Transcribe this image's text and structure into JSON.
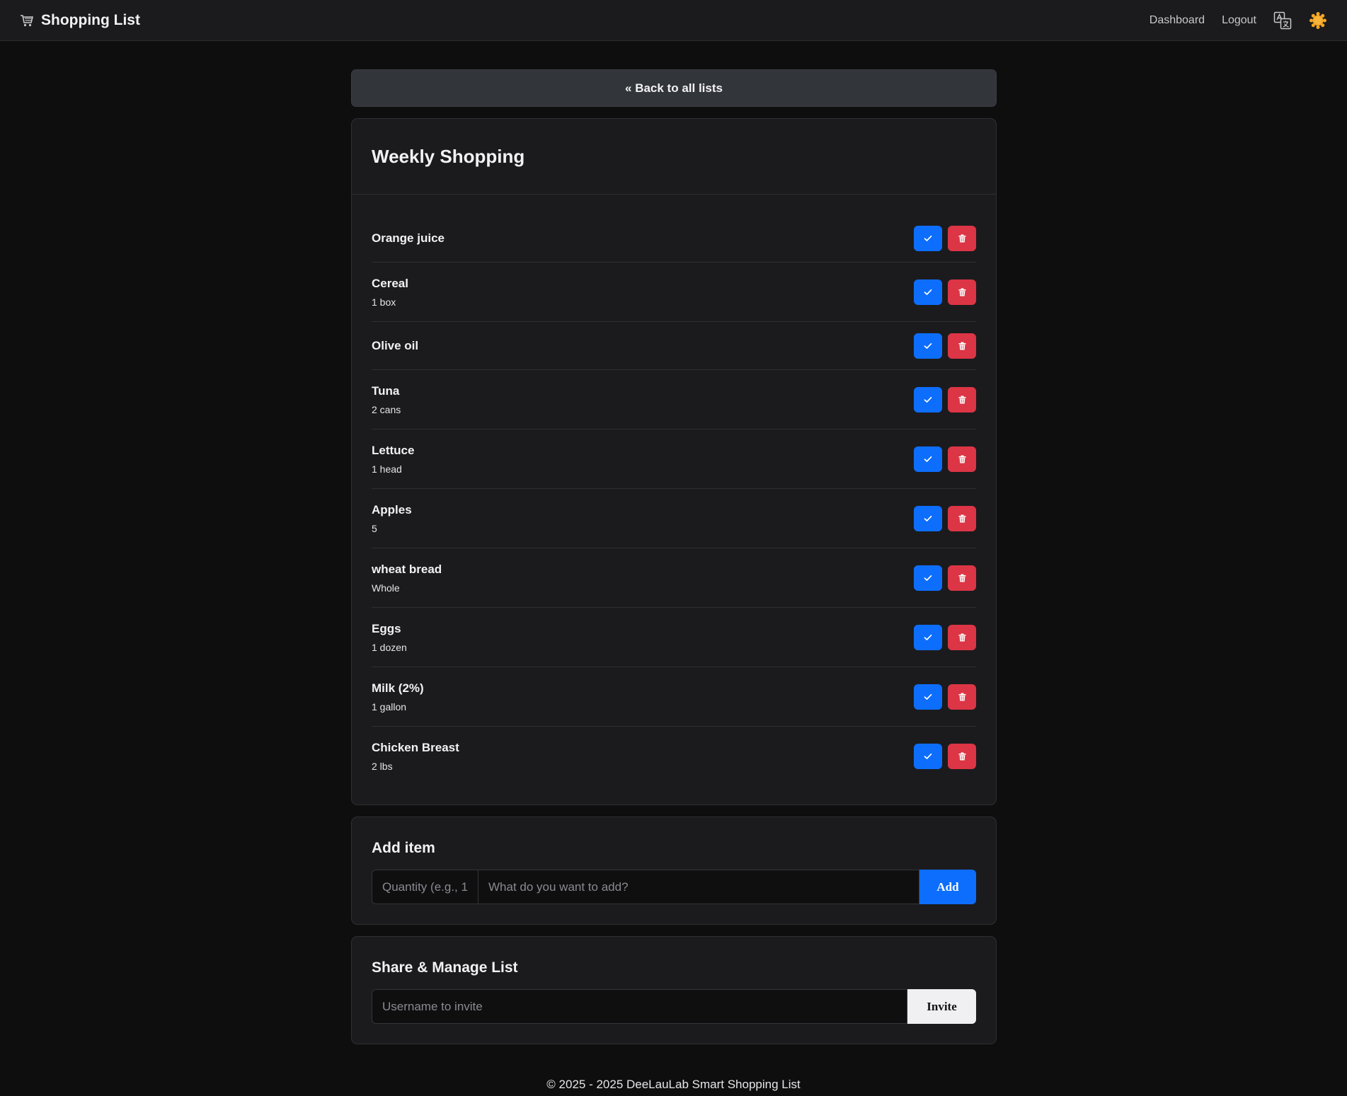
{
  "navbar": {
    "brand_icon": "cart-icon",
    "brand_title": "Shopping List",
    "links": {
      "dashboard": "Dashboard",
      "logout": "Logout"
    },
    "icons": [
      "translate-icon",
      "sun-icon"
    ]
  },
  "back_button": "« Back to all lists",
  "list": {
    "title": "Weekly Shopping",
    "items": [
      {
        "name": "Orange juice",
        "qty": ""
      },
      {
        "name": "Cereal",
        "qty": "1 box"
      },
      {
        "name": "Olive oil",
        "qty": ""
      },
      {
        "name": "Tuna",
        "qty": "2 cans"
      },
      {
        "name": "Lettuce",
        "qty": "1 head"
      },
      {
        "name": "Apples",
        "qty": "5"
      },
      {
        "name": "wheat bread",
        "qty": "Whole"
      },
      {
        "name": "Eggs",
        "qty": "1 dozen"
      },
      {
        "name": "Milk (2%)",
        "qty": "1 gallon"
      },
      {
        "name": "Chicken Breast",
        "qty": "2 lbs"
      }
    ],
    "item_icons": {
      "check": "check-icon",
      "delete": "trash-icon"
    }
  },
  "add_item": {
    "title": "Add item",
    "qty_placeholder": "Quantity (e.g., 1",
    "what_placeholder": "What do you want to add?",
    "button": "Add"
  },
  "share": {
    "title": "Share & Manage List",
    "username_placeholder": "Username to invite",
    "button": "Invite"
  },
  "footer": "© 2025 - 2025 DeeLauLab Smart Shopping List",
  "colors": {
    "primary": "#0d6efd",
    "danger": "#dc3545",
    "background": "#0e0e0f",
    "card": "#1b1b1e",
    "sun": "#f5a623"
  }
}
